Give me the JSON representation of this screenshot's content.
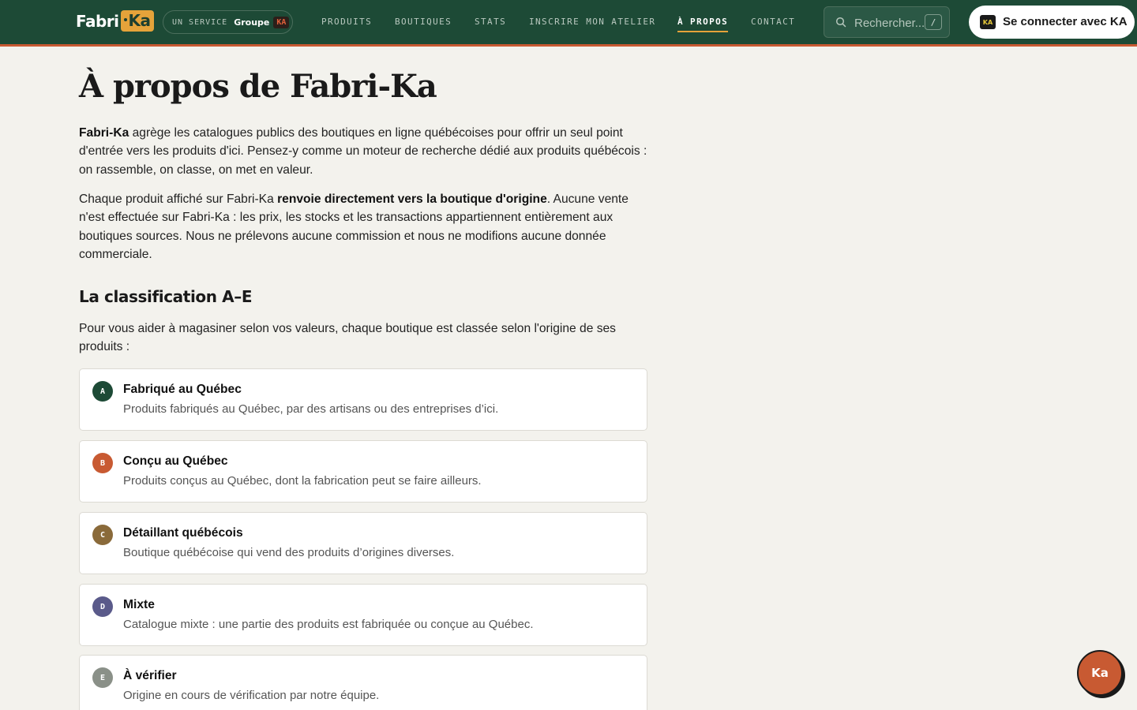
{
  "header": {
    "logo": {
      "text": "Fabri",
      "badge": "Ka"
    },
    "service": {
      "prefix": "UN SERVICE",
      "group": "Groupe",
      "group_badge": "KA"
    },
    "nav": [
      {
        "label": "PRODUITS",
        "active": false
      },
      {
        "label": "BOUTIQUES",
        "active": false
      },
      {
        "label": "STATS",
        "active": false
      },
      {
        "label": "INSCRIRE MON ATELIER",
        "active": false
      },
      {
        "label": "À PROPOS",
        "active": true
      },
      {
        "label": "CONTACT",
        "active": false
      }
    ],
    "search": {
      "placeholder": "Rechercher...",
      "shortcut": "/"
    },
    "login": {
      "icon_text": "KA",
      "label": "Se connecter avec KA"
    }
  },
  "main": {
    "title": "À propos de Fabri-Ka",
    "intro": {
      "bold": "Fabri-Ka",
      "text": " agrège les catalogues publics des boutiques en ligne québécoises pour offrir un seul point d'entrée vers les produits d'ici. Pensez-y comme un moteur de recherche dédié aux produits québécois : on rassemble, on classe, on met en valeur."
    },
    "redirect": {
      "before": "Chaque produit affiché sur Fabri-Ka ",
      "bold": "renvoie directement vers la boutique d'origine",
      "after": ". Aucune vente n'est effectuée sur Fabri-Ka : les prix, les stocks et les transactions appartiennent entièrement aux boutiques sources. Nous ne prélevons aucune commission et nous ne modifions aucune donnée commerciale."
    },
    "classification": {
      "heading": "La classification A–E",
      "lead": "Pour vous aider à magasiner selon vos valeurs, chaque boutique est classée selon l'origine de ses produits :",
      "grades": [
        {
          "letter": "A",
          "title": "Fabriqué au Québec",
          "description": "Produits fabriqués au Québec, par des artisans ou des entreprises d’ici.",
          "color": "#1d4a36"
        },
        {
          "letter": "B",
          "title": "Conçu au Québec",
          "description": "Produits conçus au Québec, dont la fabrication peut se faire ailleurs.",
          "color": "#c85a32"
        },
        {
          "letter": "C",
          "title": "Détaillant québécois",
          "description": "Boutique québécoise qui vend des produits d’origines diverses.",
          "color": "#8a6a3a"
        },
        {
          "letter": "D",
          "title": "Mixte",
          "description": "Catalogue mixte : une partie des produits est fabriquée ou conçue au Québec.",
          "color": "#5a5a8a"
        },
        {
          "letter": "E",
          "title": "À vérifier",
          "description": "Origine en cours de vérification par notre équipe.",
          "color": "#8a9088"
        }
      ]
    }
  },
  "fab": {
    "label": "Ka"
  },
  "colors": {
    "header_bg": "#1d4a36",
    "accent": "#c85a32",
    "brand_yellow": "#e5a33a",
    "page_bg": "#f3f2ed"
  }
}
